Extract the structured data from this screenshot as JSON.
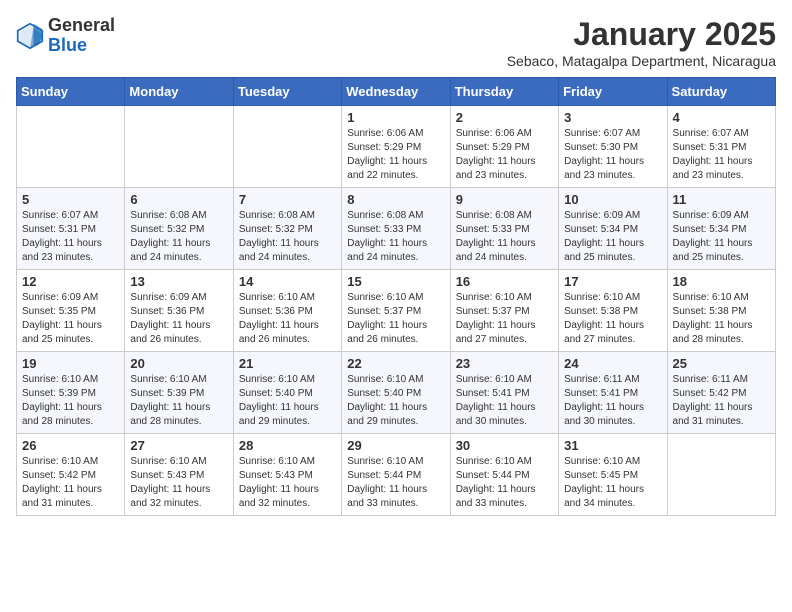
{
  "header": {
    "logo_general": "General",
    "logo_blue": "Blue",
    "month_title": "January 2025",
    "subtitle": "Sebaco, Matagalpa Department, Nicaragua"
  },
  "days_of_week": [
    "Sunday",
    "Monday",
    "Tuesday",
    "Wednesday",
    "Thursday",
    "Friday",
    "Saturday"
  ],
  "weeks": [
    [
      {
        "day": "",
        "info": ""
      },
      {
        "day": "",
        "info": ""
      },
      {
        "day": "",
        "info": ""
      },
      {
        "day": "1",
        "info": "Sunrise: 6:06 AM\nSunset: 5:29 PM\nDaylight: 11 hours\nand 22 minutes."
      },
      {
        "day": "2",
        "info": "Sunrise: 6:06 AM\nSunset: 5:29 PM\nDaylight: 11 hours\nand 23 minutes."
      },
      {
        "day": "3",
        "info": "Sunrise: 6:07 AM\nSunset: 5:30 PM\nDaylight: 11 hours\nand 23 minutes."
      },
      {
        "day": "4",
        "info": "Sunrise: 6:07 AM\nSunset: 5:31 PM\nDaylight: 11 hours\nand 23 minutes."
      }
    ],
    [
      {
        "day": "5",
        "info": "Sunrise: 6:07 AM\nSunset: 5:31 PM\nDaylight: 11 hours\nand 23 minutes."
      },
      {
        "day": "6",
        "info": "Sunrise: 6:08 AM\nSunset: 5:32 PM\nDaylight: 11 hours\nand 24 minutes."
      },
      {
        "day": "7",
        "info": "Sunrise: 6:08 AM\nSunset: 5:32 PM\nDaylight: 11 hours\nand 24 minutes."
      },
      {
        "day": "8",
        "info": "Sunrise: 6:08 AM\nSunset: 5:33 PM\nDaylight: 11 hours\nand 24 minutes."
      },
      {
        "day": "9",
        "info": "Sunrise: 6:08 AM\nSunset: 5:33 PM\nDaylight: 11 hours\nand 24 minutes."
      },
      {
        "day": "10",
        "info": "Sunrise: 6:09 AM\nSunset: 5:34 PM\nDaylight: 11 hours\nand 25 minutes."
      },
      {
        "day": "11",
        "info": "Sunrise: 6:09 AM\nSunset: 5:34 PM\nDaylight: 11 hours\nand 25 minutes."
      }
    ],
    [
      {
        "day": "12",
        "info": "Sunrise: 6:09 AM\nSunset: 5:35 PM\nDaylight: 11 hours\nand 25 minutes."
      },
      {
        "day": "13",
        "info": "Sunrise: 6:09 AM\nSunset: 5:36 PM\nDaylight: 11 hours\nand 26 minutes."
      },
      {
        "day": "14",
        "info": "Sunrise: 6:10 AM\nSunset: 5:36 PM\nDaylight: 11 hours\nand 26 minutes."
      },
      {
        "day": "15",
        "info": "Sunrise: 6:10 AM\nSunset: 5:37 PM\nDaylight: 11 hours\nand 26 minutes."
      },
      {
        "day": "16",
        "info": "Sunrise: 6:10 AM\nSunset: 5:37 PM\nDaylight: 11 hours\nand 27 minutes."
      },
      {
        "day": "17",
        "info": "Sunrise: 6:10 AM\nSunset: 5:38 PM\nDaylight: 11 hours\nand 27 minutes."
      },
      {
        "day": "18",
        "info": "Sunrise: 6:10 AM\nSunset: 5:38 PM\nDaylight: 11 hours\nand 28 minutes."
      }
    ],
    [
      {
        "day": "19",
        "info": "Sunrise: 6:10 AM\nSunset: 5:39 PM\nDaylight: 11 hours\nand 28 minutes."
      },
      {
        "day": "20",
        "info": "Sunrise: 6:10 AM\nSunset: 5:39 PM\nDaylight: 11 hours\nand 28 minutes."
      },
      {
        "day": "21",
        "info": "Sunrise: 6:10 AM\nSunset: 5:40 PM\nDaylight: 11 hours\nand 29 minutes."
      },
      {
        "day": "22",
        "info": "Sunrise: 6:10 AM\nSunset: 5:40 PM\nDaylight: 11 hours\nand 29 minutes."
      },
      {
        "day": "23",
        "info": "Sunrise: 6:10 AM\nSunset: 5:41 PM\nDaylight: 11 hours\nand 30 minutes."
      },
      {
        "day": "24",
        "info": "Sunrise: 6:11 AM\nSunset: 5:41 PM\nDaylight: 11 hours\nand 30 minutes."
      },
      {
        "day": "25",
        "info": "Sunrise: 6:11 AM\nSunset: 5:42 PM\nDaylight: 11 hours\nand 31 minutes."
      }
    ],
    [
      {
        "day": "26",
        "info": "Sunrise: 6:10 AM\nSunset: 5:42 PM\nDaylight: 11 hours\nand 31 minutes."
      },
      {
        "day": "27",
        "info": "Sunrise: 6:10 AM\nSunset: 5:43 PM\nDaylight: 11 hours\nand 32 minutes."
      },
      {
        "day": "28",
        "info": "Sunrise: 6:10 AM\nSunset: 5:43 PM\nDaylight: 11 hours\nand 32 minutes."
      },
      {
        "day": "29",
        "info": "Sunrise: 6:10 AM\nSunset: 5:44 PM\nDaylight: 11 hours\nand 33 minutes."
      },
      {
        "day": "30",
        "info": "Sunrise: 6:10 AM\nSunset: 5:44 PM\nDaylight: 11 hours\nand 33 minutes."
      },
      {
        "day": "31",
        "info": "Sunrise: 6:10 AM\nSunset: 5:45 PM\nDaylight: 11 hours\nand 34 minutes."
      },
      {
        "day": "",
        "info": ""
      }
    ]
  ]
}
